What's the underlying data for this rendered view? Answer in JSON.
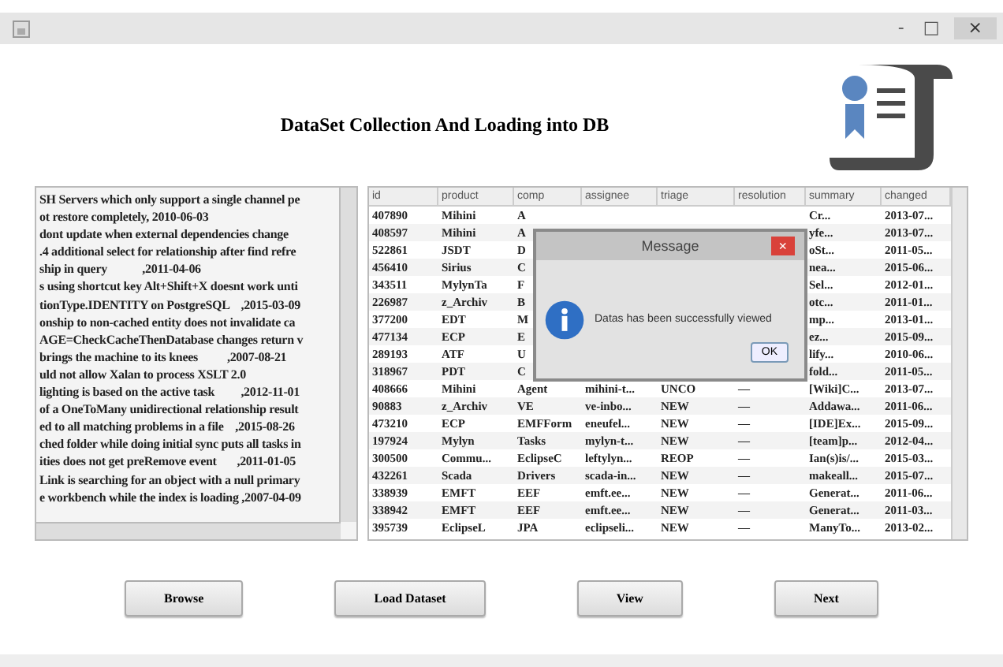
{
  "window": {
    "title_controls": [
      "-",
      "□",
      "×"
    ]
  },
  "heading": "DataSet Collection And Loading into DB",
  "log_lines": [
    "SH Servers which only support a single channel pe",
    "ot restore completely, 2010-06-03",
    "dont update when external dependencies change",
    ".4 additional select for relationship after find refre",
    "ship in query            ,2011-04-06",
    "s using shortcut key Alt+Shift+X doesnt work unti",
    "tionType.IDENTITY on PostgreSQL    ,2015-03-09",
    "onship to non-cached entity does not invalidate ca",
    "AGE=CheckCacheThenDatabase changes return v",
    "brings the machine to its knees          ,2007-08-21",
    "uld not allow Xalan to process XSLT 2.0",
    "lighting is based on the active task         ,2012-11-01",
    "of a OneToMany unidirectional relationship result",
    "ed to all matching problems in a file    ,2015-08-26",
    "ched folder while doing initial sync puts all tasks in",
    "ities does not get preRemove event       ,2011-01-05",
    "Link is searching for an object with a null primary",
    "e workbench while the index is loading ,2007-04-09"
  ],
  "table": {
    "columns": [
      "id",
      "product",
      "comp",
      "assignee",
      "triage",
      "resolution",
      "summary",
      "changed"
    ],
    "rows": [
      {
        "id": "407890",
        "product": "Mihini",
        "comp": "A",
        "summary": "Cr...",
        "changed": "2013-07..."
      },
      {
        "id": "408597",
        "product": "Mihini",
        "comp": "A",
        "summary": "yfe...",
        "changed": "2013-07..."
      },
      {
        "id": "522861",
        "product": "JSDT",
        "comp": "D",
        "summary": "oSt...",
        "changed": "2011-05..."
      },
      {
        "id": "456410",
        "product": "Sirius",
        "comp": "C",
        "summary": "nea...",
        "changed": "2015-06..."
      },
      {
        "id": "343511",
        "product": "MylynTa",
        "comp": "F",
        "summary": "Sel...",
        "changed": "2012-01..."
      },
      {
        "id": "226987",
        "product": "z_Archiv",
        "comp": "B",
        "summary": "otc...",
        "changed": "2011-01..."
      },
      {
        "id": "377200",
        "product": "EDT",
        "comp": "M",
        "summary": "mp...",
        "changed": "2013-01..."
      },
      {
        "id": "477134",
        "product": "ECP",
        "comp": "E",
        "summary": "ez...",
        "changed": "2015-09..."
      },
      {
        "id": "289193",
        "product": "ATF",
        "comp": "U",
        "summary": "lify...",
        "changed": "2010-06..."
      },
      {
        "id": "318967",
        "product": "PDT",
        "comp": "C",
        "summary": "fold...",
        "changed": "2011-05..."
      },
      {
        "id": "408666",
        "product": "Mihini",
        "comp": "Agent",
        "assignee": "mihini-t...",
        "triage": "UNCO",
        "resolution": "—",
        "summary": "[Wiki]C...",
        "changed": "2013-07..."
      },
      {
        "id": "90883",
        "product": "z_Archiv",
        "comp": "VE",
        "assignee": "ve-inbo...",
        "triage": "NEW",
        "resolution": "—",
        "summary": "Addawa...",
        "changed": "2011-06..."
      },
      {
        "id": "473210",
        "product": "ECP",
        "comp": "EMFForm",
        "assignee": "eneufel...",
        "triage": "NEW",
        "resolution": "—",
        "summary": "[IDE]Ex...",
        "changed": "2015-09..."
      },
      {
        "id": "197924",
        "product": "Mylyn",
        "comp": "Tasks",
        "assignee": "mylyn-t...",
        "triage": "NEW",
        "resolution": "—",
        "summary": "[team]p...",
        "changed": "2012-04..."
      },
      {
        "id": "300500",
        "product": "Commu...",
        "comp": "EclipseC",
        "assignee": "leftylyn...",
        "triage": "REOP",
        "resolution": "—",
        "summary": "Ian(s)is/...",
        "changed": "2015-03..."
      },
      {
        "id": "432261",
        "product": "Scada",
        "comp": "Drivers",
        "assignee": "scada-in...",
        "triage": "NEW",
        "resolution": "—",
        "summary": "makeall...",
        "changed": "2015-07..."
      },
      {
        "id": "338939",
        "product": "EMFT",
        "comp": "EEF",
        "assignee": "emft.ee...",
        "triage": "NEW",
        "resolution": "—",
        "summary": "Generat...",
        "changed": "2011-06..."
      },
      {
        "id": "338942",
        "product": "EMFT",
        "comp": "EEF",
        "assignee": "emft.ee...",
        "triage": "NEW",
        "resolution": "—",
        "summary": "Generat...",
        "changed": "2011-03..."
      },
      {
        "id": "395739",
        "product": "EclipseL",
        "comp": "JPA",
        "assignee": "eclipseli...",
        "triage": "NEW",
        "resolution": "—",
        "summary": "ManyTo...",
        "changed": "2013-02..."
      }
    ]
  },
  "dialog": {
    "title": "Message",
    "close": "×",
    "message": "Datas has been successfully viewed",
    "button": "OK"
  },
  "buttons": [
    "Browse",
    "Load Dataset",
    "View",
    "Next"
  ]
}
